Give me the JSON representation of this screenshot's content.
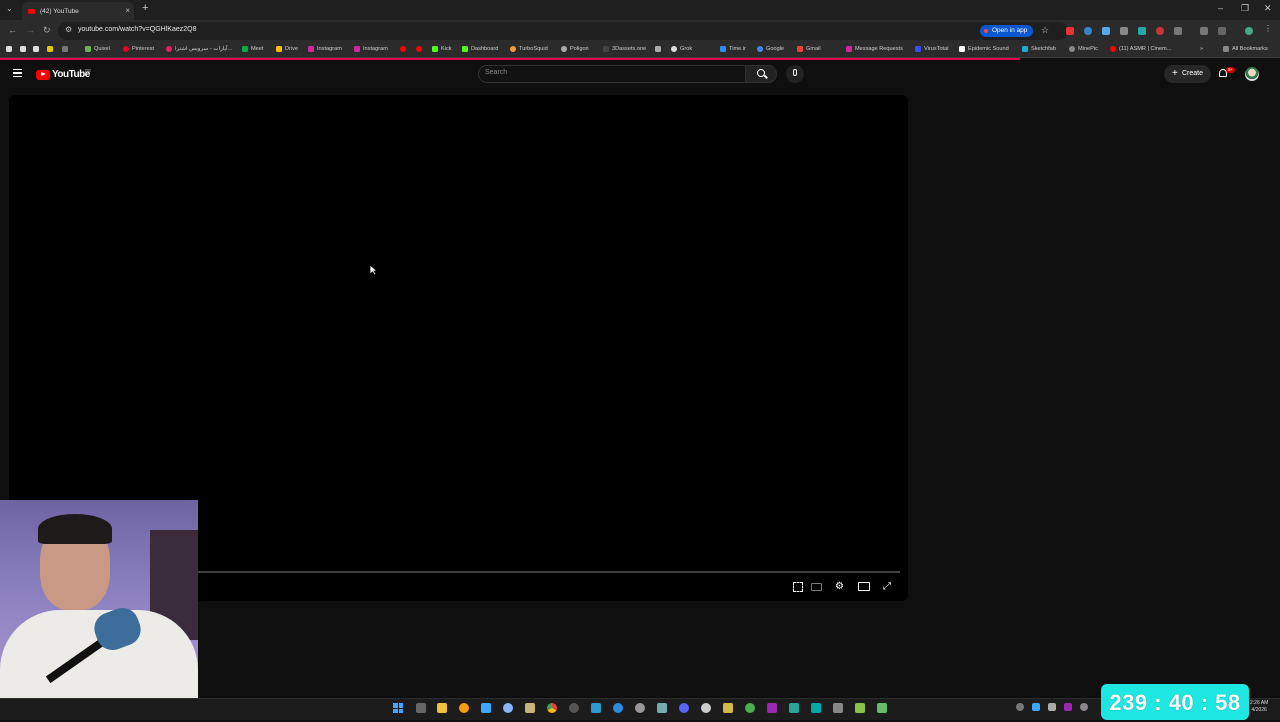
{
  "browser": {
    "tab_title": "(42) YouTube",
    "url": "youtube.com/watch?v=QGHlKaez2Q8",
    "open_in_app_label": "Open in app",
    "all_bookmarks_label": "All Bookmarks",
    "bookmarks": [
      {
        "label": "Quixel",
        "color": "#6ab04c"
      },
      {
        "label": "Pinterest",
        "color": "#e60023"
      },
      {
        "label": "آپارات - سرویس اشترا...",
        "color": "#ea1d5d"
      },
      {
        "label": "Meet",
        "color": "#00ac47"
      },
      {
        "label": "Drive",
        "color": "#fbbc04"
      },
      {
        "label": "Instagram",
        "color": "#d6249f"
      },
      {
        "label": "Instagram",
        "color": "#d6249f"
      },
      {
        "label": "",
        "color": "#ff0000"
      },
      {
        "label": "",
        "color": "#ff0000"
      },
      {
        "label": "Kick",
        "color": "#53fc18"
      },
      {
        "label": "Dashboard",
        "color": "#53fc18"
      },
      {
        "label": "TurboSquid",
        "color": "#f79a33"
      },
      {
        "label": "Poligon",
        "color": "#aaaaaa"
      },
      {
        "label": "3Dassets.one",
        "color": "#444444"
      },
      {
        "label": "",
        "color": "#aaaaaa"
      },
      {
        "label": "Grok",
        "color": "#dddddd"
      },
      {
        "label": "Time.ir",
        "color": "#2d8cff"
      },
      {
        "label": "Google",
        "color": "#4285f4"
      },
      {
        "label": "Gmail",
        "color": "#ea4335"
      },
      {
        "label": "Message Requests",
        "color": "#d6249f"
      },
      {
        "label": "VirusTotal",
        "color": "#394eff"
      },
      {
        "label": "Epidemic Sound",
        "color": "#ffffff"
      },
      {
        "label": "Sketchfab",
        "color": "#1caad9"
      },
      {
        "label": "MinePic",
        "color": "#888888"
      },
      {
        "label": "(11) ASMR | Cinem...",
        "color": "#ff0000"
      }
    ]
  },
  "youtube": {
    "logo_text": "YouTube",
    "country_code": "DE",
    "search_placeholder": "Search",
    "create_label": "Create",
    "notification_count": "9+"
  },
  "overlay": {
    "timer": "239 : 40 : 58"
  },
  "taskbar": {
    "time": "2:26 AM",
    "date": "4/2026"
  }
}
